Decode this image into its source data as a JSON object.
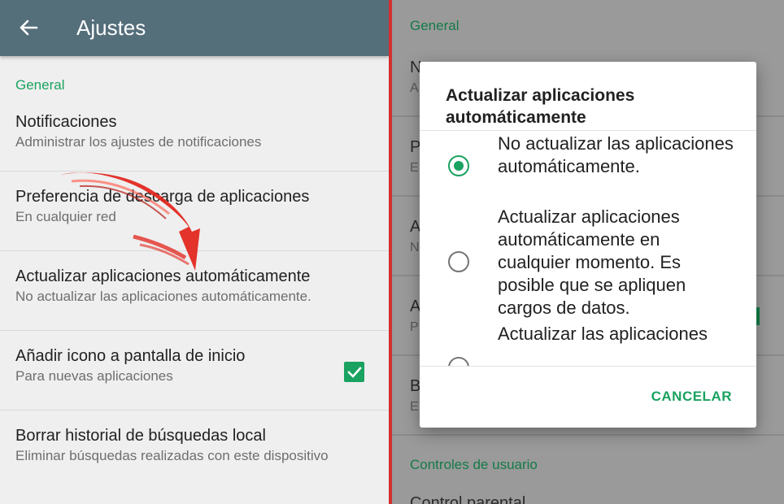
{
  "left": {
    "title": "Ajustes",
    "section": "General",
    "items": [
      {
        "title": "Notificaciones",
        "subtitle": "Administrar los ajustes de notificaciones"
      },
      {
        "title": "Preferencia de descarga de aplicaciones",
        "subtitle": "En cualquier red"
      },
      {
        "title": "Actualizar aplicaciones automáticamente",
        "subtitle": "No actualizar las aplicaciones automáticamente."
      },
      {
        "title": "Añadir icono a pantalla de inicio",
        "subtitle": "Para nuevas aplicaciones",
        "checked": true
      },
      {
        "title": "Borrar historial de búsquedas local",
        "subtitle": "Eliminar búsquedas realizadas con este dispositivo"
      }
    ]
  },
  "right_background": {
    "section_general": "General",
    "section_controls": "Controles de usuario",
    "fragments": [
      "N",
      "A",
      "P",
      "E",
      "A",
      "N",
      "A",
      "P",
      "B",
      "E"
    ],
    "last_item_partial": "Control parental"
  },
  "dialog": {
    "title": "Actualizar aplicaciones automáticamente",
    "options": [
      {
        "label": "No actualizar las aplicaciones automáticamente.",
        "selected": true
      },
      {
        "label": "Actualizar aplicaciones automáticamente en cualquier momento. Es posible que se apliquen cargos de datos.",
        "selected": false
      },
      {
        "label": "Actualizar las aplicaciones",
        "selected": false
      }
    ],
    "cancel_label": "CANCELAR"
  },
  "colors": {
    "appbar": "#546e7a",
    "accent_green": "#1aa260",
    "divider_red": "#d32f2f"
  },
  "icons": [
    "back-arrow-icon",
    "checkbox-checked-icon",
    "red-arrow-annotation-icon"
  ]
}
